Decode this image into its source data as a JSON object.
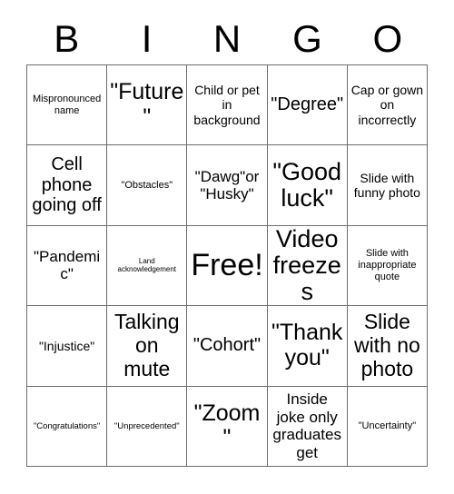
{
  "card": {
    "title": "BINGO",
    "header_letters": [
      "B",
      "I",
      "N",
      "G",
      "O"
    ],
    "free_space_index": 12,
    "colors": {
      "background": "#ffffff",
      "text": "#000000",
      "grid_line": "#6e6e6e"
    },
    "rows": [
      [
        {
          "label": "Mispronounced name",
          "size": "s-sm"
        },
        {
          "label": "\"Future\"",
          "size": "s-3xl"
        },
        {
          "label": "Child or pet in background",
          "size": "s-md"
        },
        {
          "label": "\"Degree\"",
          "size": "s-xl"
        },
        {
          "label": "Cap or gown on incorrectly",
          "size": "s-md"
        }
      ],
      [
        {
          "label": "Cell phone going off",
          "size": "s-xl"
        },
        {
          "label": "\"Obstacles\"",
          "size": "s-sm"
        },
        {
          "label": "\"Dawg\"or \"Husky\"",
          "size": "s-lg"
        },
        {
          "label": "\"Good luck\"",
          "size": "s-4xl"
        },
        {
          "label": "Slide with funny photo",
          "size": "s-md"
        }
      ],
      [
        {
          "label": "\"Pandemic\"",
          "size": "s-lg"
        },
        {
          "label": "Land acknowledgement",
          "size": "s-xxs"
        },
        {
          "label": "Free!",
          "size": "s-free"
        },
        {
          "label": "Video freezes",
          "size": "s-4xl"
        },
        {
          "label": "Slide with inappropriate quote",
          "size": "s-sm"
        }
      ],
      [
        {
          "label": "\"Injustice\"",
          "size": "s-md"
        },
        {
          "label": "Talking on mute",
          "size": "s-2xl"
        },
        {
          "label": "\"Cohort\"",
          "size": "s-xl"
        },
        {
          "label": "\"Thank you\"",
          "size": "s-3xl"
        },
        {
          "label": "Slide with no photo",
          "size": "s-2xl"
        }
      ],
      [
        {
          "label": "\"Congratulations\"",
          "size": "s-xs"
        },
        {
          "label": "\"Unprecedented\"",
          "size": "s-xs"
        },
        {
          "label": "\"Zoom\"",
          "size": "s-3xl"
        },
        {
          "label": "Inside joke only graduates get",
          "size": "s-lg"
        },
        {
          "label": "\"Uncertainty\"",
          "size": "s-sm"
        }
      ]
    ]
  }
}
